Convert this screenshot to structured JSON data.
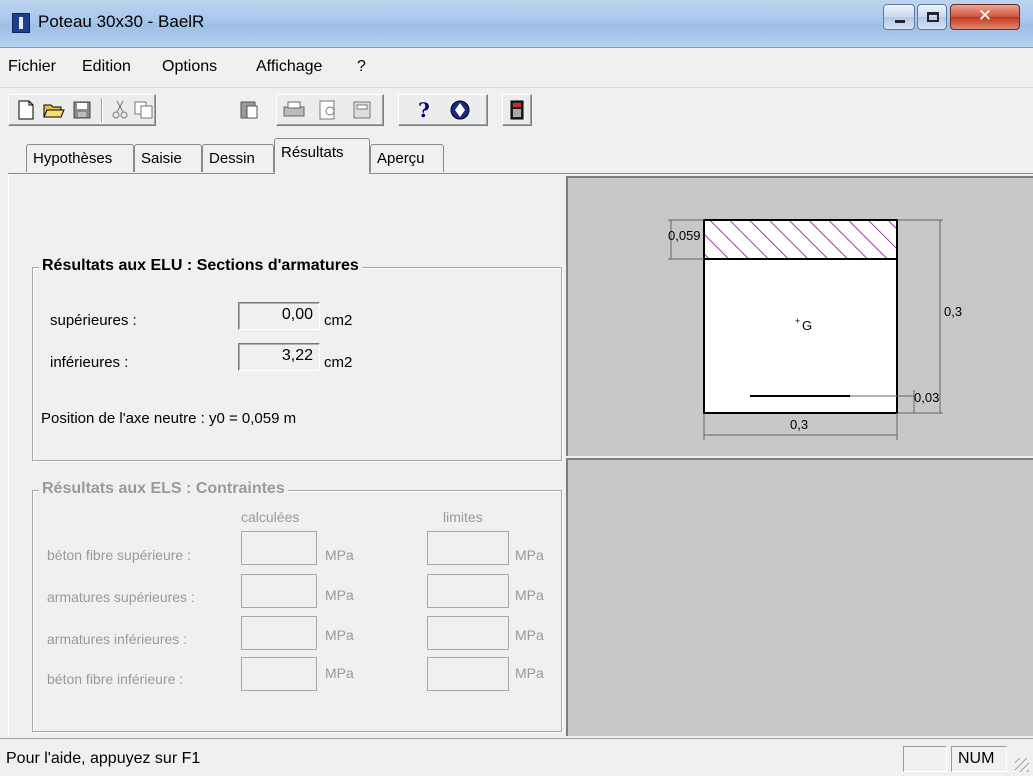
{
  "window": {
    "title": "Poteau 30x30 - BaelR"
  },
  "menu": {
    "items": [
      "Fichier",
      "Edition",
      "Options",
      "Affichage",
      "?"
    ]
  },
  "toolbar": {
    "icons": [
      "new-file-icon",
      "open-folder-icon",
      "save-icon",
      "cut-icon",
      "copy-icon",
      "paste-icon",
      "print-icon",
      "print-preview-icon",
      "print-setup-icon",
      "help-icon",
      "context-help-icon",
      "calculator-icon"
    ]
  },
  "tabs": [
    "Hypothèses",
    "Saisie",
    "Dessin",
    "Résultats",
    "Aperçu"
  ],
  "active_tab": "Résultats",
  "elu": {
    "title": "Résultats aux ELU : Sections d'armatures",
    "sup_label": "supérieures :",
    "sup_value": "0,00",
    "sup_unit": "cm2",
    "inf_label": "inférieures :",
    "inf_value": "3,22",
    "inf_unit": "cm2",
    "axis_text": "Position de l'axe neutre : y0 = 0,059 m"
  },
  "els": {
    "title": "Résultats aux ELS : Contraintes",
    "col_calc": "calculées",
    "col_lim": "limites",
    "unit": "MPa",
    "rows": [
      "béton fibre supérieure :",
      "armatures supérieures :",
      "armatures inférieures :",
      "béton fibre inférieure :"
    ]
  },
  "drawing": {
    "dim_top": "0,059",
    "dim_height": "0,3",
    "dim_width": "0,3",
    "dim_cover": "0,03",
    "centroid_label": "G",
    "hatch_color": "#a03ca0"
  },
  "status": {
    "help_text": "Pour l'aide, appuyez sur F1",
    "num_indicator": "NUM"
  }
}
